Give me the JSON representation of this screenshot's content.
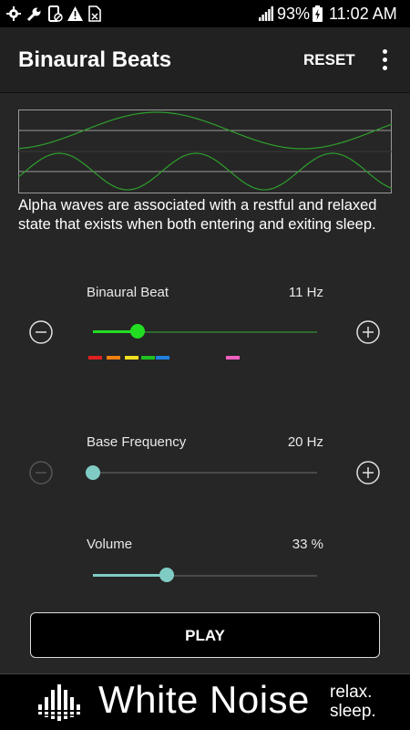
{
  "statusbar": {
    "battery_percent": "93%",
    "time": "11:02 AM",
    "icons": [
      "settings-icon",
      "wrench-icon",
      "phone-off-icon",
      "warning-icon",
      "sim-icon",
      "signal-icon",
      "battery-charging-icon"
    ]
  },
  "appbar": {
    "title": "Binaural Beats",
    "reset_label": "RESET",
    "menu_icon": "more-vert-icon"
  },
  "description": "Alpha waves are associated with a restful and relaxed state that exists when both entering and exiting sleep.",
  "controls": {
    "binaural_beat": {
      "label": "Binaural Beat",
      "value_text": "11 Hz",
      "level": 0.2,
      "color": "#22dd22",
      "band_colors": [
        "#e02020",
        "#f08010",
        "#f0e020",
        "#20c020",
        "#2080e0",
        "#f060c0"
      ]
    },
    "base_frequency": {
      "label": "Base Frequency",
      "value_text": "20 Hz",
      "level": 0.0,
      "color": "#80cbc4"
    },
    "volume": {
      "label": "Volume",
      "value_text": "33 %",
      "level": 0.33,
      "color": "#80cbc4"
    }
  },
  "play_label": "PLAY",
  "banner": {
    "title": "White Noise",
    "tagline_1": "relax.",
    "tagline_2": "sleep."
  },
  "colors": {
    "wave": "#2e9e2e",
    "background": "#262626",
    "appbar": "#212121"
  }
}
